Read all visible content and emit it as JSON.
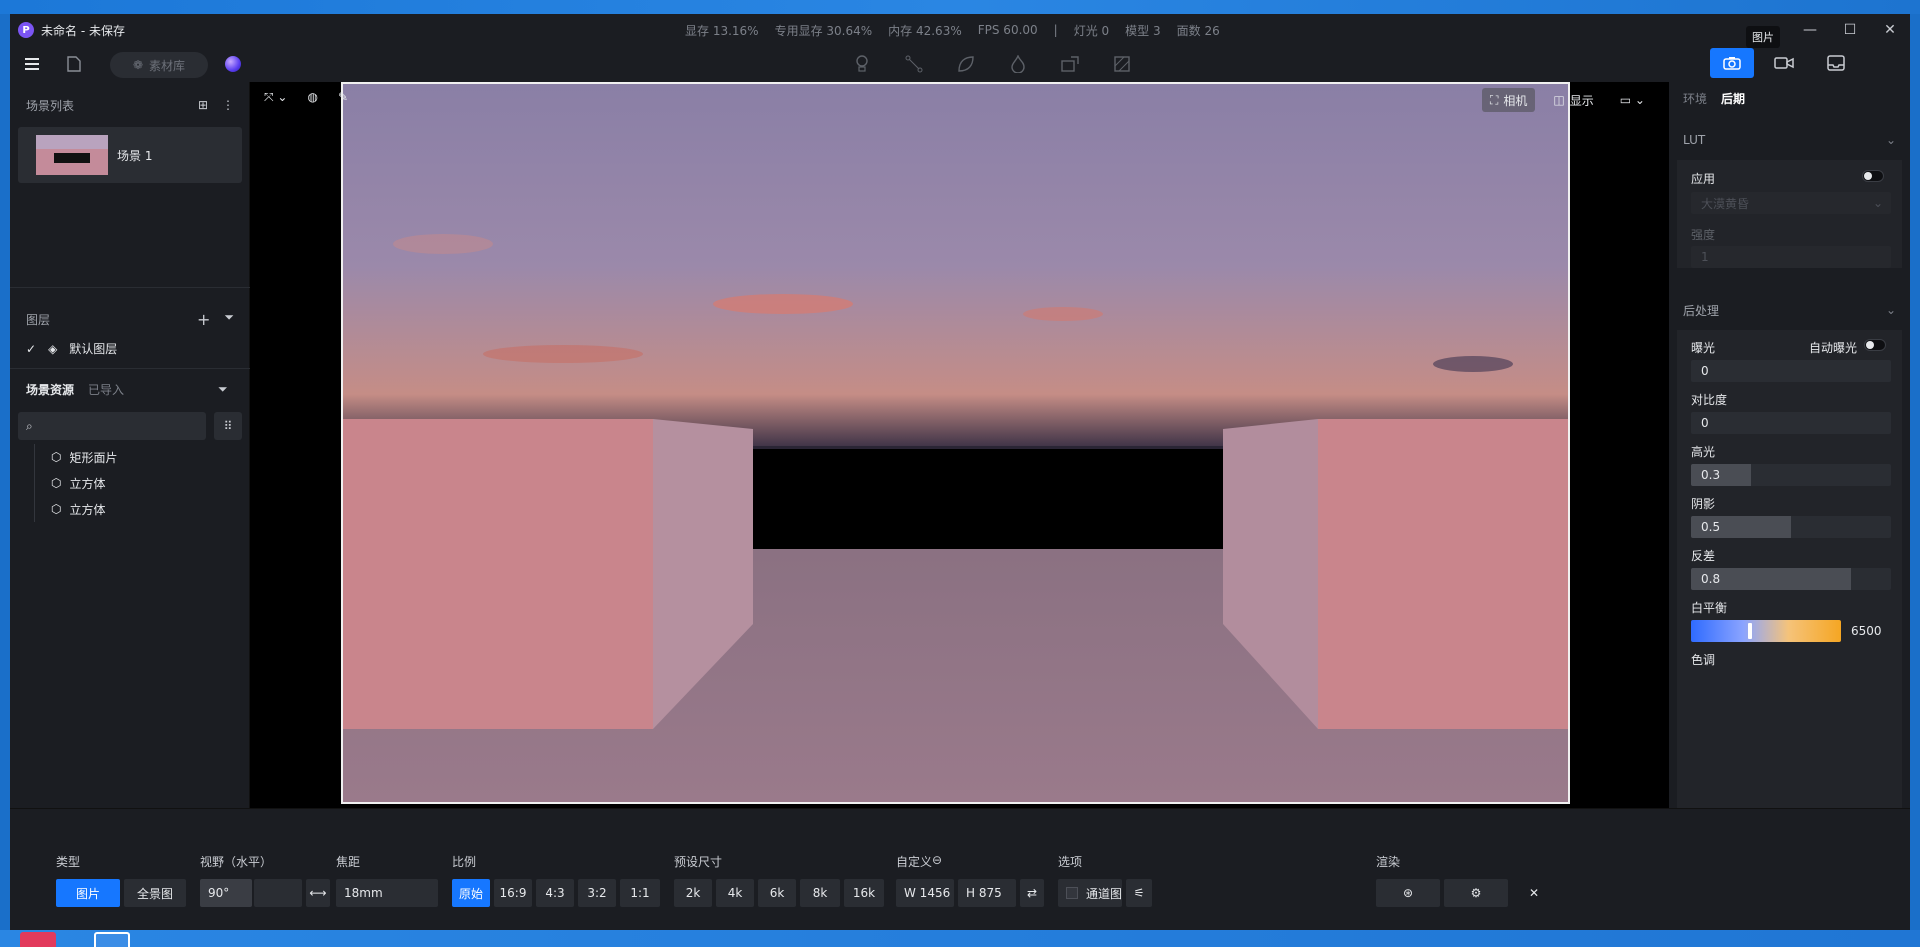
{
  "window": {
    "title": "未命名 - 未保存",
    "stats": [
      "显存 13.16%",
      "专用显存 30.64%",
      "内存 42.63%",
      "FPS 60.00",
      "|",
      "灯光 0",
      "模型 3",
      "面数 26"
    ],
    "tooltip": "图片"
  },
  "toolbar": {
    "library_label": "素材库"
  },
  "left": {
    "scenes_title": "场景列表",
    "scene_name": "场景 1",
    "layers_title": "图层",
    "default_layer": "默认图层",
    "assets_tab": "场景资源",
    "imported_tab": "已导入",
    "search_placeholder": "",
    "tree": [
      "矩形面片",
      "立方体",
      "立方体"
    ]
  },
  "viewport": {
    "camera_label": "相机",
    "display_label": "显示"
  },
  "right": {
    "tab_env": "环境",
    "tab_post": "后期",
    "lut_title": "LUT",
    "apply_label": "应用",
    "lut_preset": "大漠黄昏",
    "intensity_label": "强度",
    "intensity_value": "1",
    "post_title": "后处理",
    "exposure_label": "曝光",
    "auto_exposure_label": "自动曝光",
    "exposure_value": "0",
    "contrast_label": "对比度",
    "contrast_value": "0",
    "highlight_label": "高光",
    "highlight_value": "0.3",
    "shadow_label": "阴影",
    "shadow_value": "0.5",
    "diff_label": "反差",
    "diff_value": "0.8",
    "wb_label": "白平衡",
    "wb_value": "6500",
    "tone_label": "色调"
  },
  "bottom": {
    "type_label": "类型",
    "type_image": "图片",
    "type_pano": "全景图",
    "fov_label": "视野（水平）",
    "fov_value": "90°",
    "focal_label": "焦距",
    "focal_value": "18mm",
    "ratio_label": "比例",
    "ratios": [
      "原始",
      "16:9",
      "4:3",
      "3:2",
      "1:1"
    ],
    "preset_label": "预设尺寸",
    "presets": [
      "2k",
      "4k",
      "6k",
      "8k",
      "16k"
    ],
    "custom_label": "自定义",
    "w_value": "W  1456",
    "h_value": "H  875",
    "options_label": "选项",
    "channel_label": "通道图",
    "render_label": "渲染"
  },
  "colors": {
    "accent": "#1677ff",
    "panel": "#1b1d22",
    "field": "#2a2d33"
  }
}
